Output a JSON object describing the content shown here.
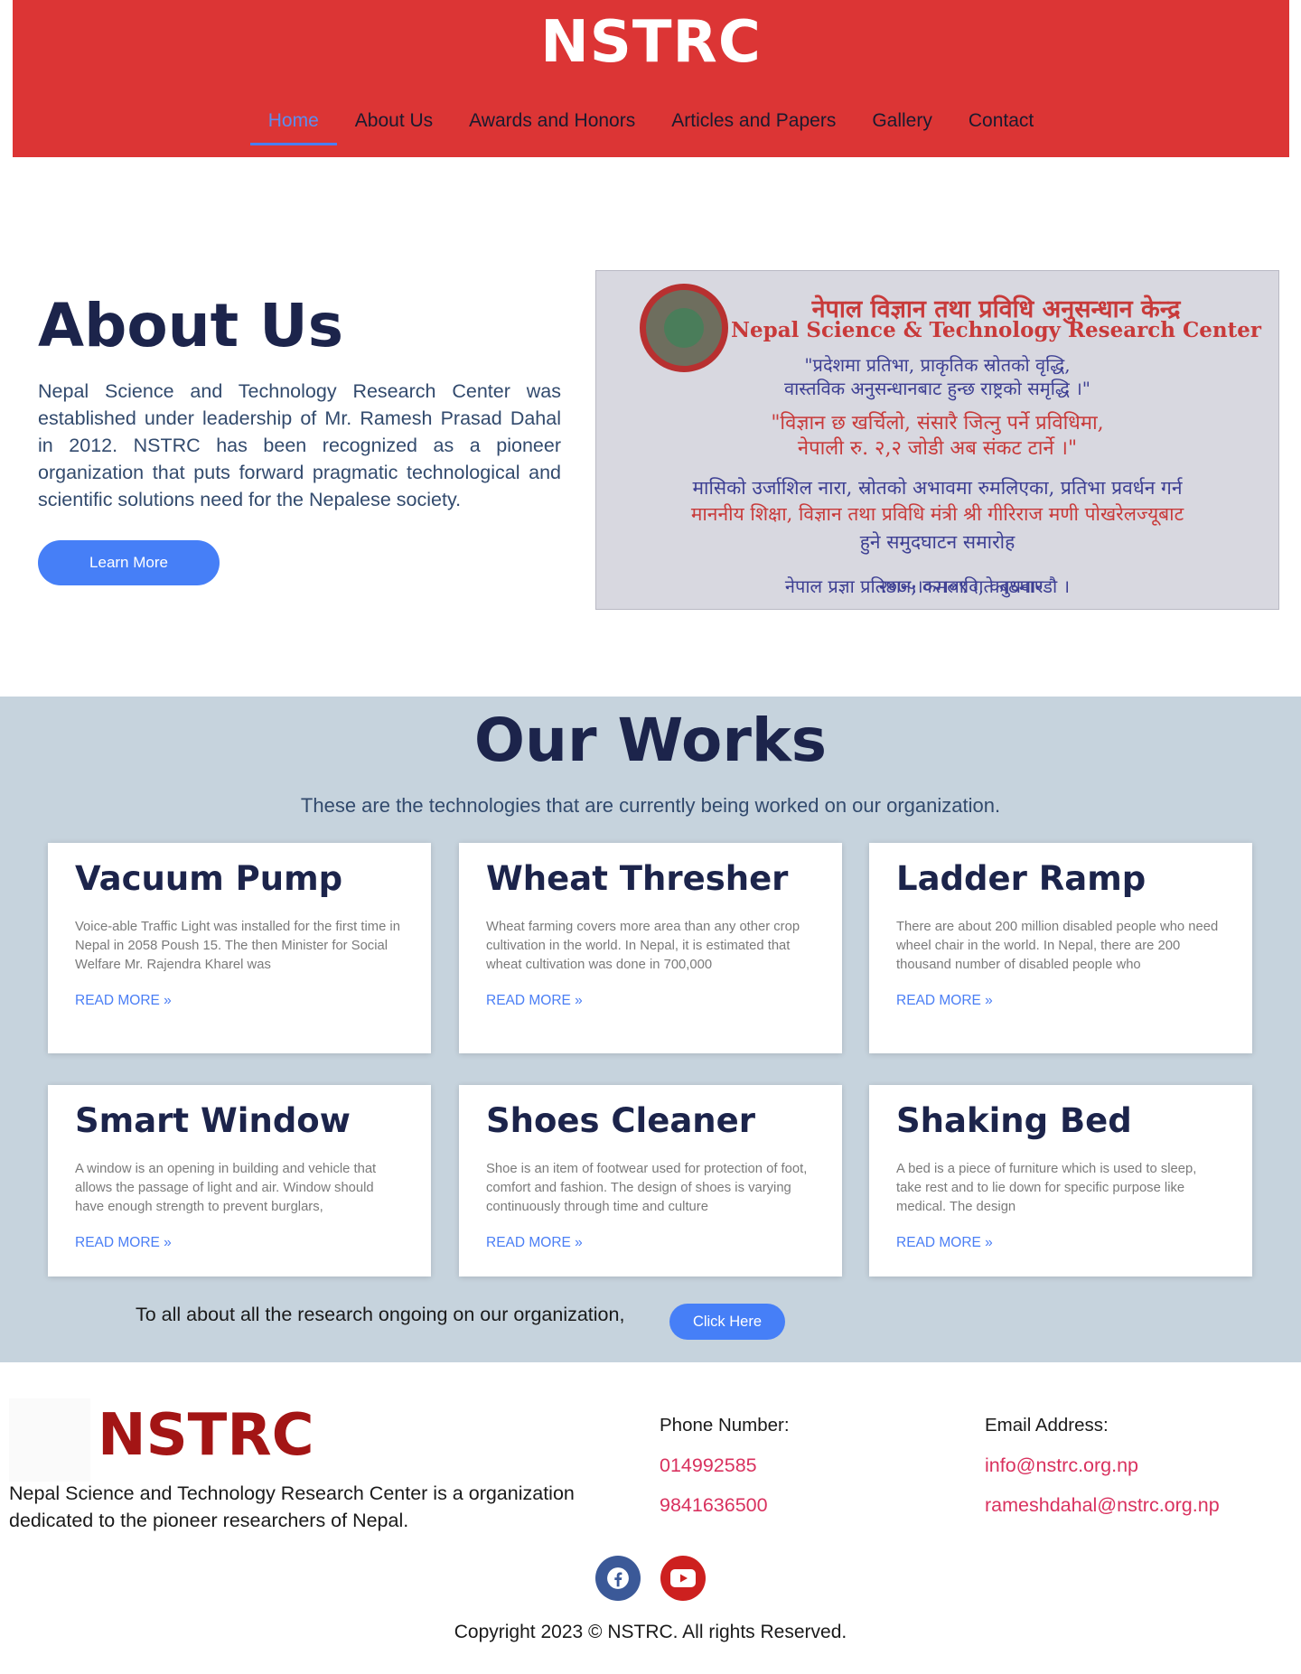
{
  "header": {
    "brand": "NSTRC",
    "nav": [
      "Home",
      "About Us",
      "Awards and Honors",
      "Articles and Papers",
      "Gallery",
      "Contact"
    ],
    "active_nav": "Home"
  },
  "about": {
    "title": "About Us",
    "text": "Nepal Science and Technology Research Center was established under leadership of  Mr. Ramesh Prasad Dahal in 2012. NSTRC has been recognized as a pioneer organization that puts forward pragmatic technological and scientific solutions need for the Nepalese society.",
    "button": "Learn More",
    "banner_lines": [
      "नेपाल विज्ञान तथा प्रविधि अनुसन्धान केन्द्र",
      "Nepal Science & Technology Research Center",
      "\"प्रदेशमा प्रतिभा, प्राकृतिक स्रोतको वृद्धि,",
      "वास्तविक अनुसन्धानबाट हुन्छ राष्ट्रको समृद्धि ।\"",
      "\"विज्ञान छ खर्चिलो, संसारै जित्नु पर्ने प्रविधिमा,",
      "नेपाली रु. २,२ जोडी अब संकट टार्ने ।\"",
      "मासिको उर्जाशिल नारा, स्रोतको अभावमा रुमलिएका, प्रतिभा प्रवर्धन गर्न",
      "माननीय शिक्षा, विज्ञान तथा प्रविधि मंत्री श्री गीरिराज मणी पोखरेलज्यूबाट",
      "हुने समुदघाटन समारोह",
      "२०७५।०२।०९ गते बुधवार",
      "नेपाल प्रज्ञा प्रतिष्ठान, कमलादि, काठमाण्डौ ।"
    ]
  },
  "works": {
    "title": "Our Works",
    "subtitle": "These are the technologies that are currently being worked on our organization.",
    "cards": [
      {
        "title": "Vacuum Pump",
        "text": "Voice-able Traffic Light was installed for the first time in Nepal in 2058 Poush 15. The then Minister for Social Welfare Mr. Rajendra Kharel was",
        "more": "READ MORE »"
      },
      {
        "title": "Wheat Thresher",
        "text": "Wheat farming covers more area than any other crop cultivation in the world. In Nepal, it is estimated that wheat cultivation was done in 700,000",
        "more": "READ MORE »"
      },
      {
        "title": "Ladder Ramp",
        "text": "There are about 200 million disabled people who need wheel chair in the world. In Nepal, there are 200 thousand number of disabled people who",
        "more": "READ MORE »"
      },
      {
        "title": "Smart Window",
        "text": "A window is an opening in building and vehicle that allows the passage of light and air. Window should have enough strength to prevent burglars,",
        "more": "READ MORE »"
      },
      {
        "title": "Shoes Cleaner",
        "text": "Shoe is an item of footwear used for protection of foot, comfort and fashion. The design of shoes is varying continuously through time and culture",
        "more": "READ MORE »"
      },
      {
        "title": "Shaking Bed",
        "text": "A bed is a piece of furniture which is used to sleep, take rest and to lie down for specific purpose like medical. The design",
        "more": "READ MORE »"
      }
    ],
    "research_text": "To all about all the research ongoing on our organization,",
    "research_button": "Click Here"
  },
  "footer": {
    "brand": "NSTRC",
    "description": "Nepal Science and Technology Research Center is a organization dedicated to the pioneer researchers of Nepal.",
    "phone_label": "Phone Number:",
    "phones": [
      "014992585",
      "9841636500"
    ],
    "email_label": "Email Address:",
    "emails": [
      "info@nstrc.org.np",
      "rameshdahal@nstrc.org.np"
    ],
    "social": [
      "facebook-icon",
      "youtube-icon"
    ],
    "copyright": "Copyright 2023 © NSTRC. All rights Reserved."
  }
}
